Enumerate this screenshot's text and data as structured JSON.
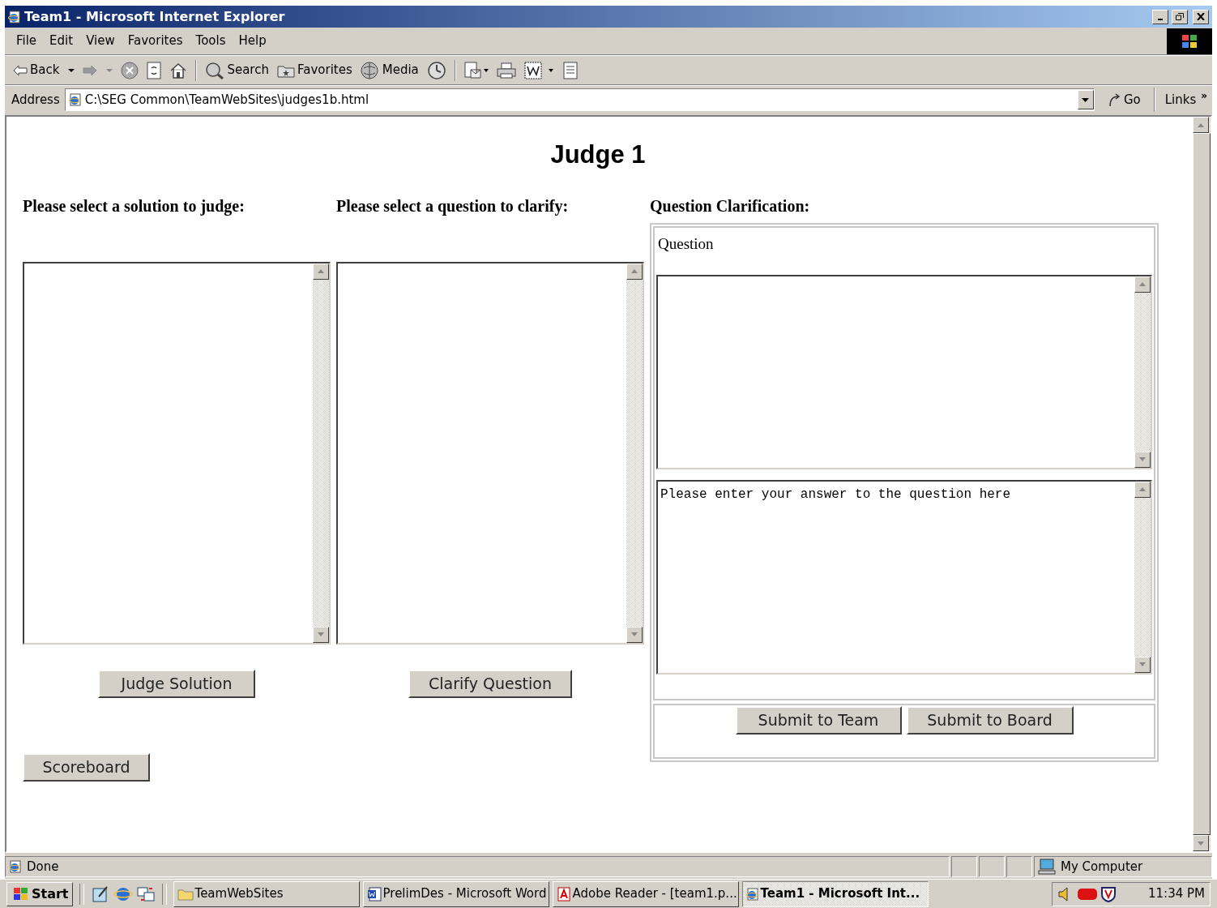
{
  "window": {
    "title": "Team1 - Microsoft Internet Explorer"
  },
  "menu": [
    "File",
    "Edit",
    "View",
    "Favorites",
    "Tools",
    "Help"
  ],
  "toolbar": [
    {
      "kind": "back",
      "label": "Back"
    },
    {
      "kind": "forward"
    },
    {
      "kind": "stop"
    },
    {
      "kind": "refresh"
    },
    {
      "kind": "home"
    },
    {
      "kind": "search",
      "label": "Search"
    },
    {
      "kind": "favorites",
      "label": "Favorites"
    },
    {
      "kind": "media",
      "label": "Media"
    },
    {
      "kind": "history"
    },
    {
      "kind": "mail"
    },
    {
      "kind": "print"
    },
    {
      "kind": "edit"
    },
    {
      "kind": "discuss"
    }
  ],
  "address_bar": {
    "label": "Address",
    "value": "C:\\SEG Common\\TeamWebSites\\judges1b.html",
    "go": "Go",
    "links": "Links",
    "more": "»"
  },
  "page": {
    "heading": "Judge 1",
    "solutions": {
      "label": "Please select a solution to judge:",
      "button": "Judge Solution"
    },
    "questions": {
      "label": "Please select a question to clarify:",
      "button": "Clarify Question"
    },
    "clarification": {
      "label": "Question Clarification:",
      "question_label": "Question",
      "answer_value": "Please enter your answer to the question here",
      "buttons": [
        "Submit to Team",
        "Submit to Board"
      ]
    },
    "scoreboard_button": "Scoreboard"
  },
  "status_bar": {
    "text": "Done",
    "zone": "My Computer"
  },
  "taskbar": {
    "start": "Start",
    "tasks": [
      {
        "label": "TeamWebSites",
        "kind": "folder",
        "selected": false
      },
      {
        "label": "PrelimDes - Microsoft Word",
        "kind": "word",
        "selected": false
      },
      {
        "label": "Adobe Reader - [team1.p...",
        "kind": "pdf",
        "selected": false
      },
      {
        "label": "Team1 - Microsoft Int...",
        "kind": "ie",
        "selected": true
      }
    ],
    "clock": "11:34 PM"
  }
}
